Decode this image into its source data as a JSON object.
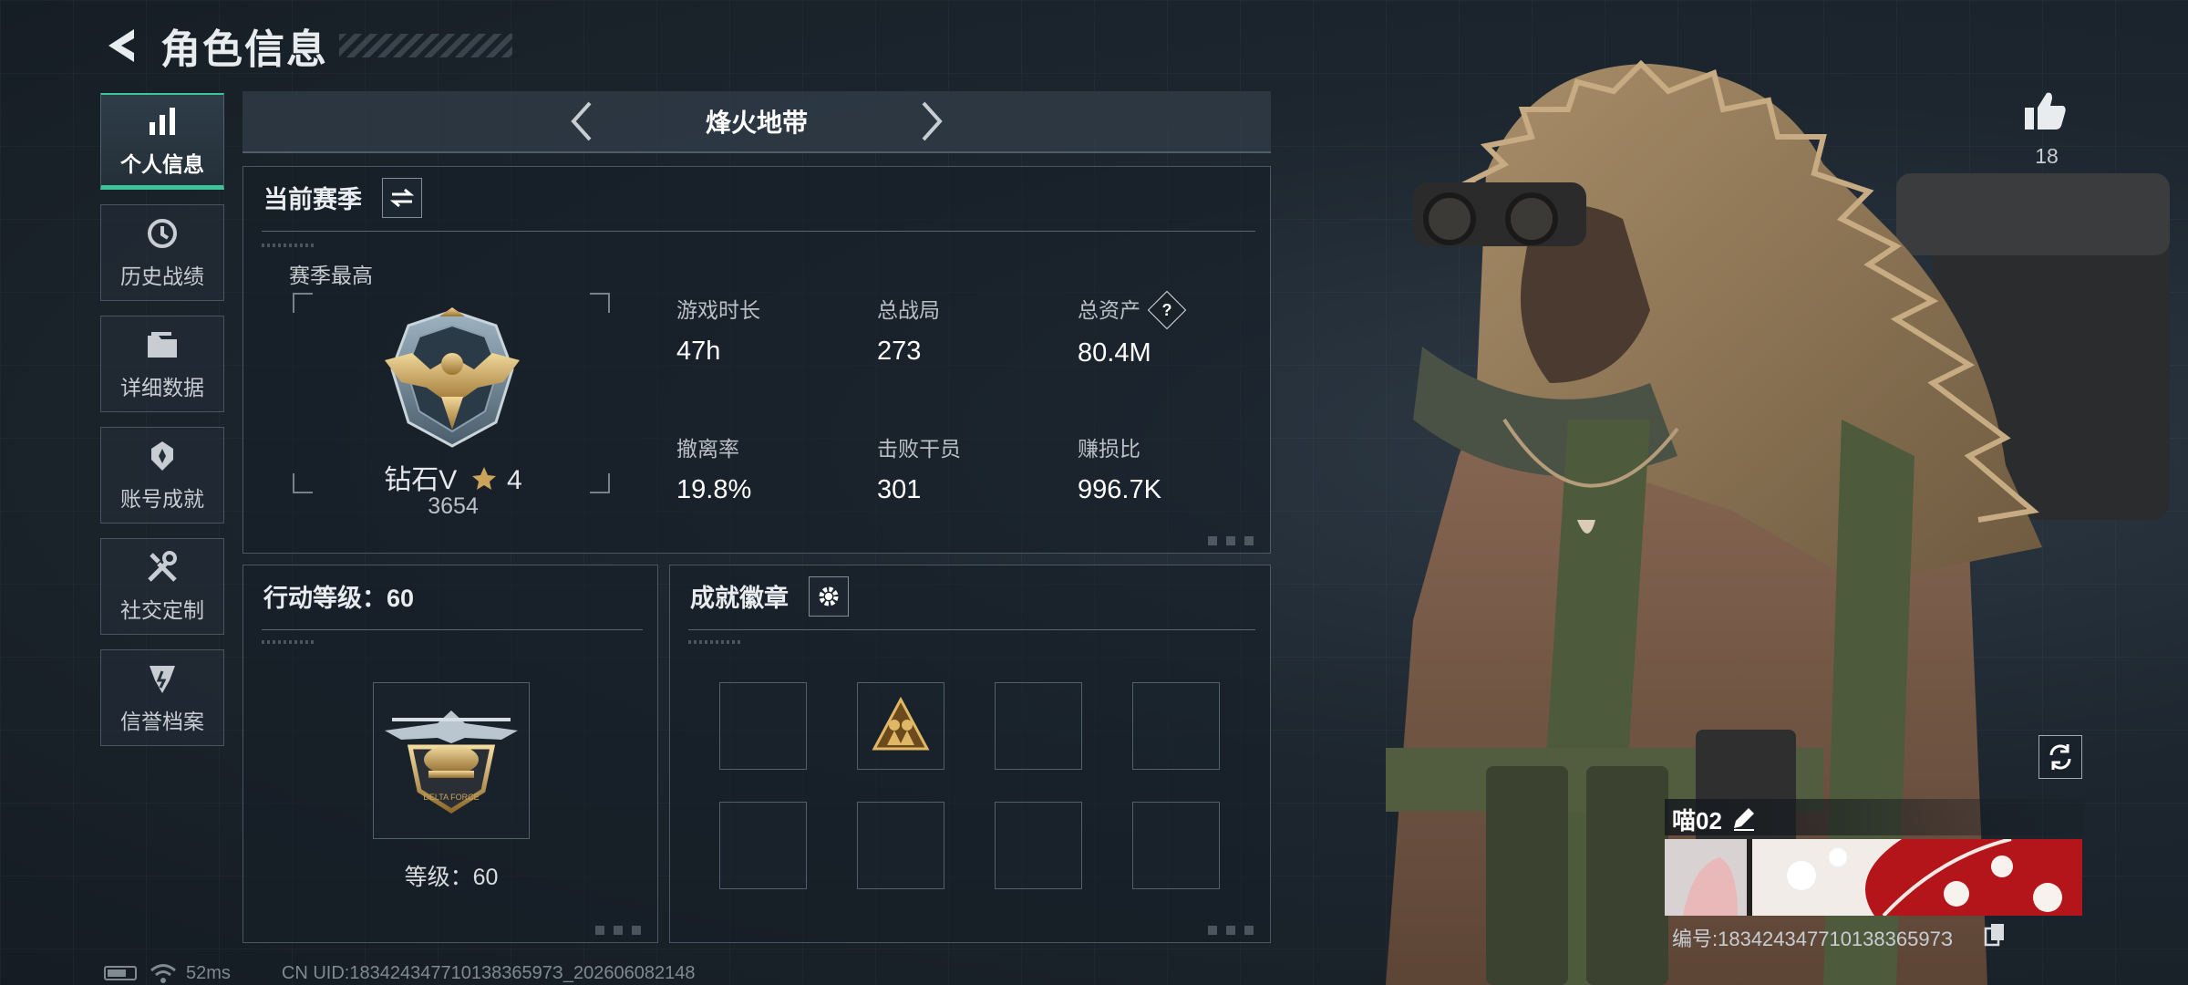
{
  "header": {
    "title": "角色信息"
  },
  "sidebar": {
    "items": [
      {
        "label": "个人信息",
        "icon": "bar-chart-icon",
        "active": true
      },
      {
        "label": "历史战绩",
        "icon": "history-icon",
        "active": false
      },
      {
        "label": "详细数据",
        "icon": "folder-icon",
        "active": false
      },
      {
        "label": "账号成就",
        "icon": "achievement-icon",
        "active": false
      },
      {
        "label": "社交定制",
        "icon": "tools-icon",
        "active": false
      },
      {
        "label": "信誉档案",
        "icon": "credit-icon",
        "active": false
      }
    ]
  },
  "mode": {
    "name": "烽火地带"
  },
  "season": {
    "title": "当前赛季",
    "best_label": "赛季最高",
    "rank_name": "钻石V",
    "rank_stars": "4",
    "rank_score": "3654",
    "stats": [
      {
        "key": "游戏时长",
        "value": "47h"
      },
      {
        "key": "总战局",
        "value": "273"
      },
      {
        "key": "总资产",
        "value": "80.4M",
        "help": "?"
      },
      {
        "key": "撤离率",
        "value": "19.8%"
      },
      {
        "key": "击败干员",
        "value": "301"
      },
      {
        "key": "赚损比",
        "value": "996.7K"
      }
    ]
  },
  "action_level": {
    "title": "行动等级：60",
    "level_text": "等级：60",
    "emblem_text": "DELTA FORCE"
  },
  "badges": {
    "title": "成就徽章",
    "slot_count": 8
  },
  "profile": {
    "likes": "18",
    "player_name": "喵02",
    "uid_line": "编号:18342434771013836597З"
  },
  "footer": {
    "ping": "52ms",
    "uid": "CN UID:18342434771013836597З_202606082148"
  },
  "colors": {
    "accent": "#3ec49a",
    "gold": "#c9a45a",
    "banner_red": "#b3151b"
  }
}
